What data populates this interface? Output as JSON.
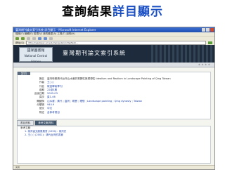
{
  "slide": {
    "title_black": "查詢結果",
    "title_blue": "詳目顯示"
  },
  "browser": {
    "window_title": "臺灣期刊論文索引系統 詳目顯示 - Microsoft Internet Explorer",
    "menu": "檔案(F)  編輯(E)  檢視(V)  我的最愛(A)  工具(T)  說明(H)",
    "address_label": "網址(D)",
    "url": "http://readopac.ncl.edu.tw/cgi-bin/ncltw/fast/...",
    "status": "完成"
  },
  "site": {
    "logo_line1": "國家圖書館",
    "logo_line2": "National Central Library",
    "system_name": "臺灣期刊論文索引系統",
    "nav_hint": "＊ ＊ ＊ ＊"
  },
  "record": {
    "tab_label": "詳目",
    "rows": [
      {
        "key": "篇名",
        "value": "臺灣時期清代台灣山水畫的寫實性與理想性 Idealism and Realism in Landscape Painting of Qing Taiwan"
      },
      {
        "key": "作者",
        "value": "王○○"
      },
      {
        "key": "刊名",
        "value": "故宮學術季刊"
      },
      {
        "key": "卷期",
        "value": "22卷3期"
      },
      {
        "key": "出版日期",
        "value": "2005.03"
      },
      {
        "key": "頁次",
        "value": "頁1-46"
      },
      {
        "key": "關鍵詞",
        "value": "山水畫 ; 清代 ; 臺灣 ; 寫實 ; 理想 ; Landscape painting ; Qing dynasty ; Taiwan"
      },
      {
        "key": "分類號",
        "value": "940.9"
      },
      {
        "key": "語文",
        "value": "中文"
      },
      {
        "key": "附註",
        "value": "含參考書目"
      }
    ]
  },
  "lower_tabs": {
    "tab1": "書目資料",
    "tab2": "參考文獻資料"
  },
  "references": {
    "header": "參考文獻",
    "items": [
      "1. 臺灣省文獻委員會 (1990)：臺灣史",
      "2. 王○○ (2001)：清代台灣的書畫"
    ]
  }
}
